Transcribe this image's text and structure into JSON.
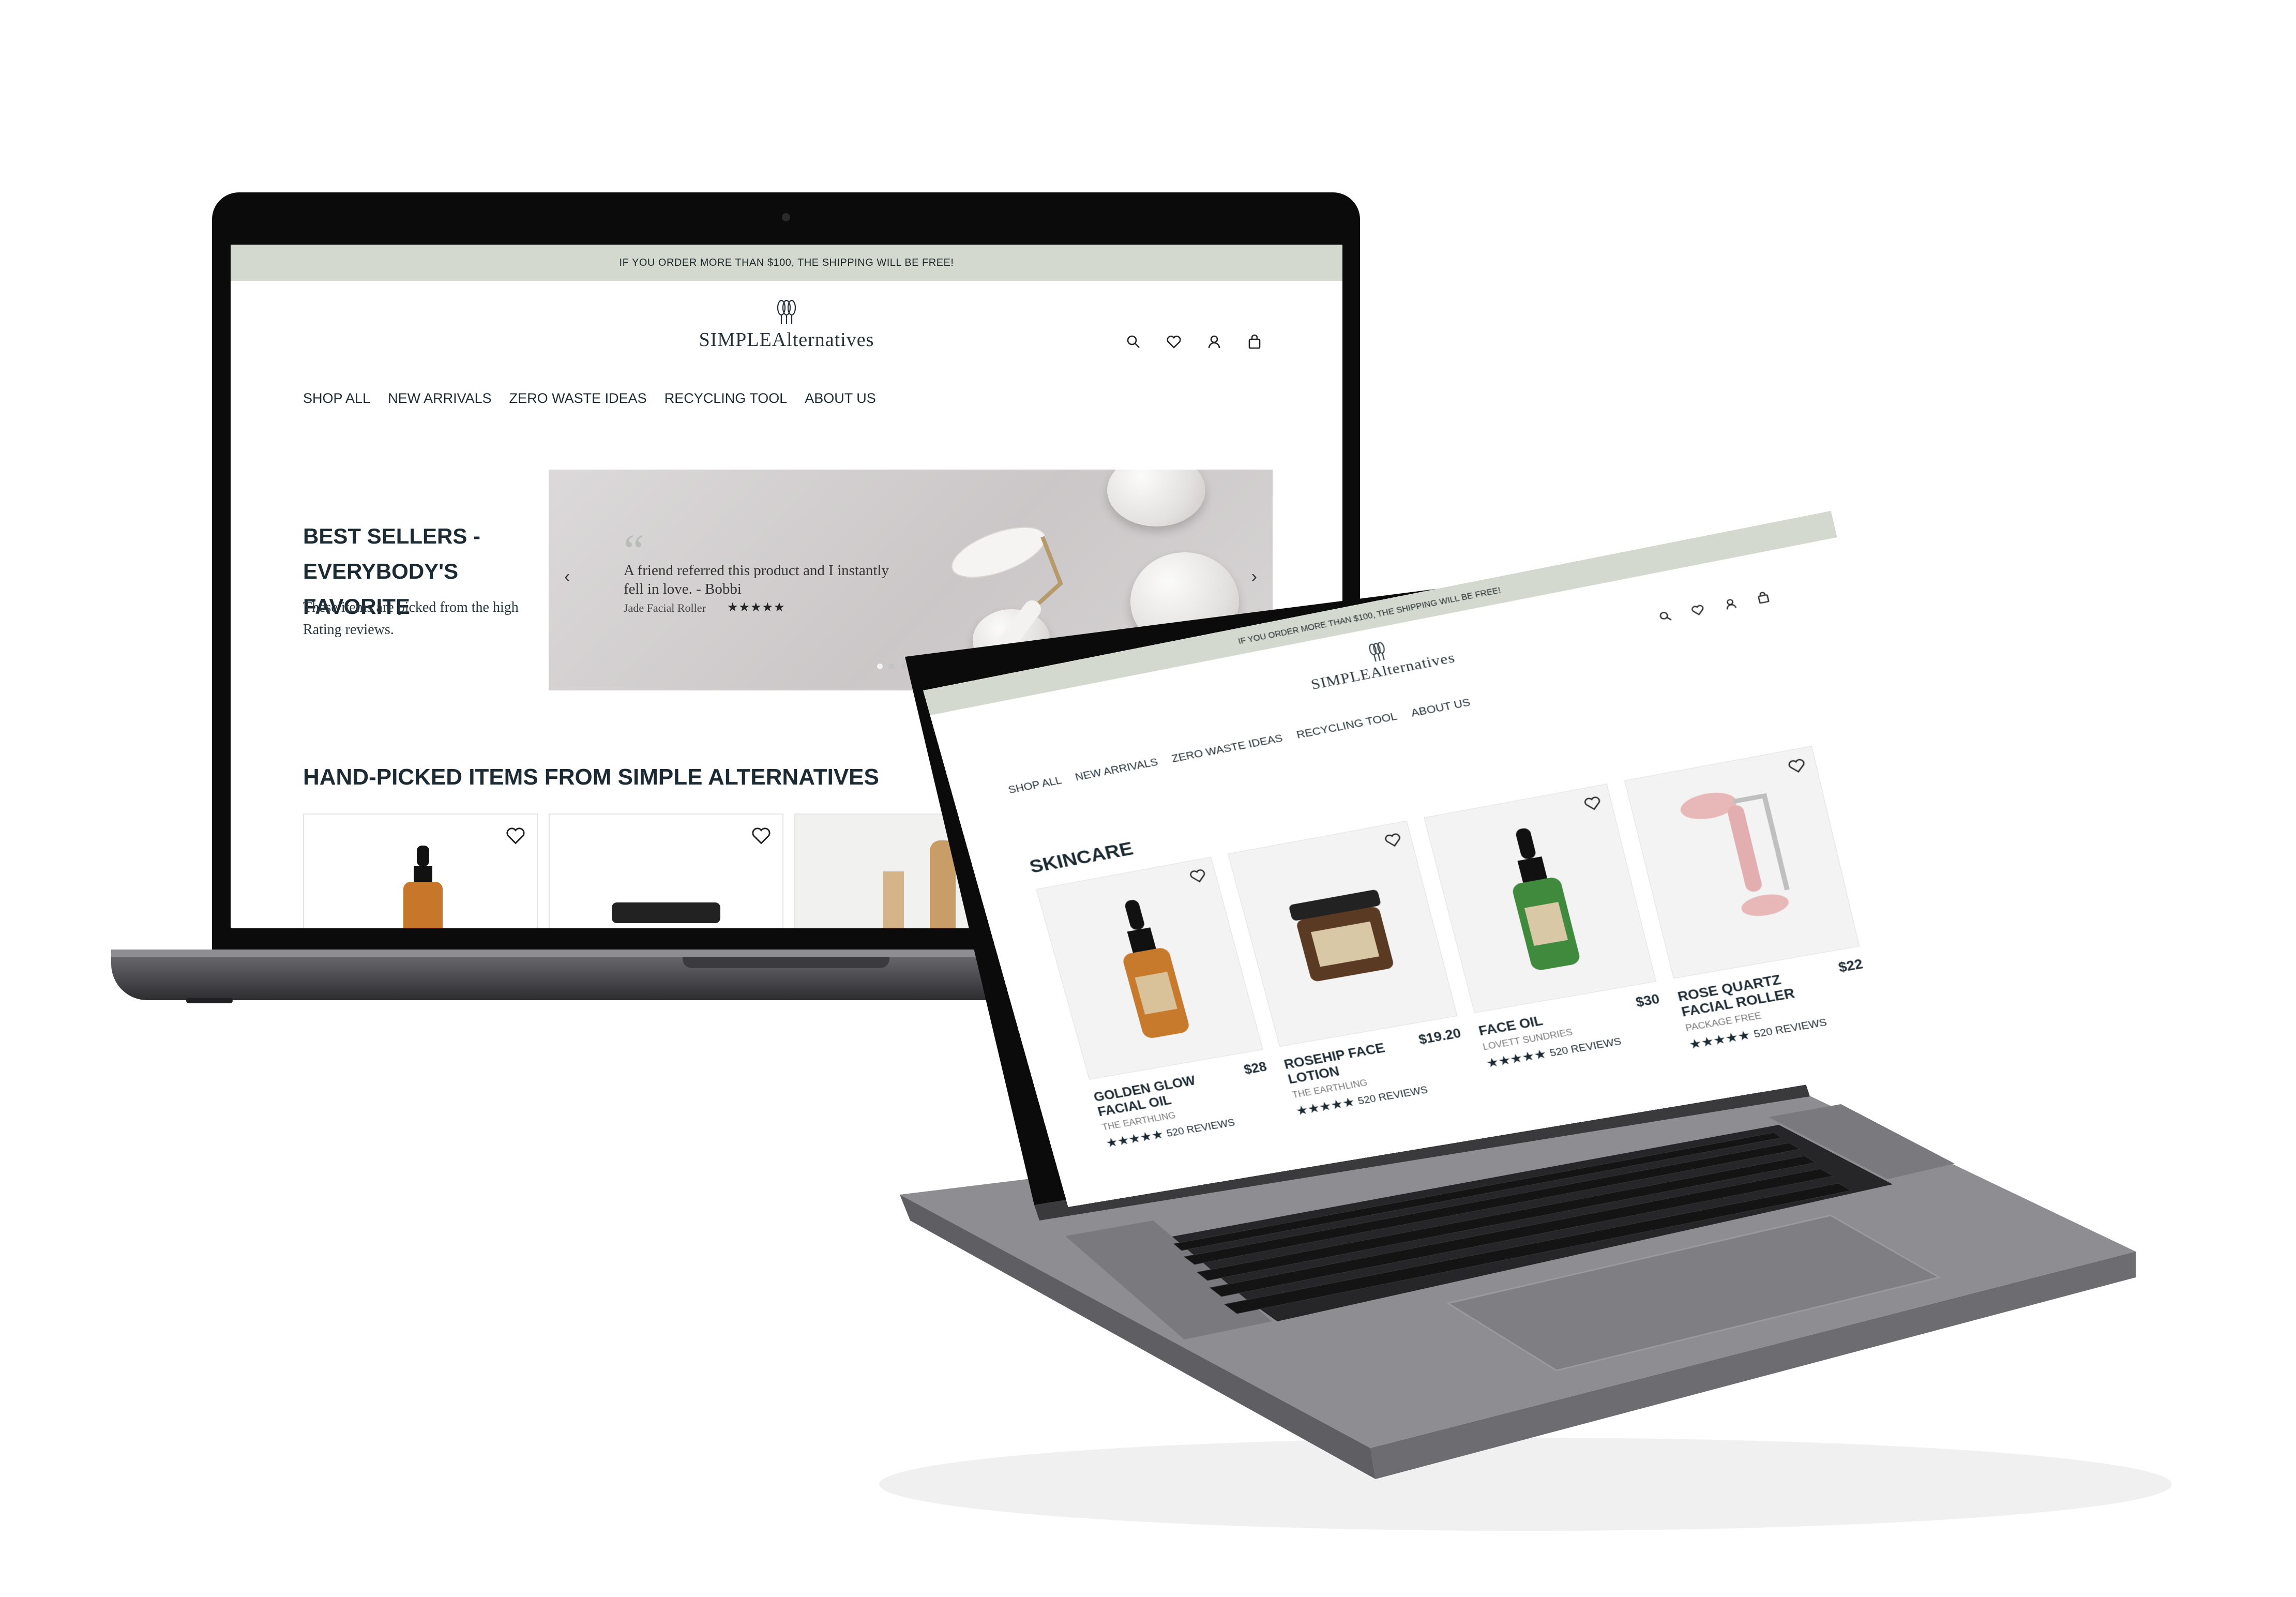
{
  "banner": "IF YOU ORDER MORE THAN $100, THE SHIPPING WILL BE FREE!",
  "logo": {
    "word1": "SIMPLE",
    "word2": "Alternatives"
  },
  "header_icons": [
    "search-icon",
    "heart-icon",
    "user-icon",
    "bag-icon"
  ],
  "nav": [
    "SHOP ALL",
    "NEW ARRIVALS",
    "ZERO WASTE IDEAS",
    "RECYCLING TOOL",
    "ABOUT US"
  ],
  "best_sellers": {
    "title_line1": "BEST SELLERS -",
    "title_line2": "EVERYBODY'S FAVORITE",
    "subtitle": "These items are picked from the high Rating reviews."
  },
  "testimonial": {
    "quote": "A friend referred this product and I instantly fell in love. - Bobbi",
    "product": "Jade Facial Roller",
    "stars": "★★★★★"
  },
  "handpicked_title": "HAND-PICKED ITEMS FROM SIMPLE ALTERNATIVES",
  "skincare_title": "SKINCARE",
  "products": [
    {
      "name": "GOLDEN GLOW FACIAL OIL",
      "price": "$28",
      "brand": "THE EARTHLING",
      "stars": "★★★★★",
      "reviews": "520 REVIEWS"
    },
    {
      "name": "ROSEHIP FACE LOTION",
      "price": "$19.20",
      "brand": "THE EARTHLING",
      "stars": "★★★★★",
      "reviews": "520 REVIEWS"
    },
    {
      "name": "FACE OIL",
      "price": "$30",
      "brand": "LOVETT SUNDRIES",
      "stars": "★★★★★",
      "reviews": "520 REVIEWS"
    },
    {
      "name": "ROSE QUARTZ FACIAL ROLLER",
      "price": "$22",
      "brand": "PACKAGE FREE",
      "stars": "★★★★★",
      "reviews": "520 REVIEWS"
    }
  ],
  "colors": {
    "banner_bg": "#d4d9cf",
    "text_dark": "#1c2a33",
    "laptop_body": "#5e5e62"
  }
}
